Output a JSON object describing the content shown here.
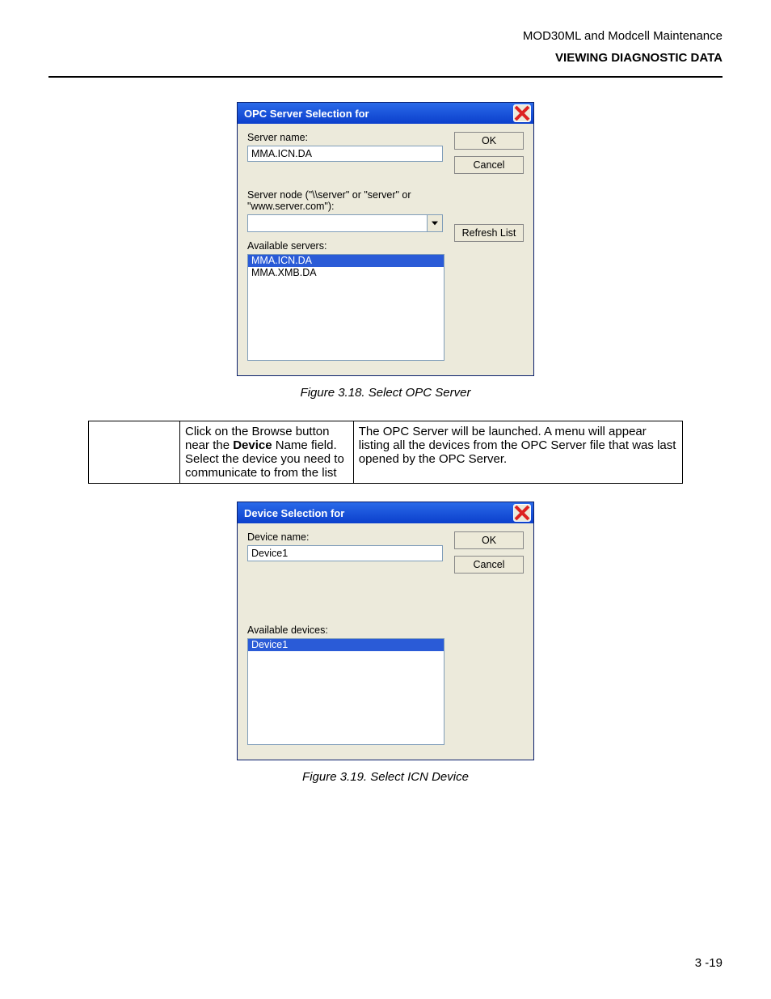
{
  "header": {
    "doc_title": "MOD30ML and Modcell Maintenance",
    "section": "VIEWING DIAGNOSTIC DATA"
  },
  "dialog1": {
    "title": "OPC Server Selection for",
    "server_name_label": "Server name:",
    "server_name_value": "MMA.ICN.DA",
    "server_node_label": "Server node (\"\\\\server\" or \"server\" or \"www.server.com\"):",
    "available_label": "Available servers:",
    "ok": "OK",
    "cancel": "Cancel",
    "refresh": "Refresh List",
    "list": [
      "MMA.ICN.DA",
      "MMA.XMB.DA"
    ],
    "selected_index": 0
  },
  "figure1_caption": "Figure 3.18. Select OPC Server",
  "table_row": {
    "left_pre": "Click on the Browse button near the ",
    "left_bold": "Device",
    "left_post": " Name field.\nSelect the device you need to communicate to from the list",
    "right": "The OPC Server will be launched. A menu will appear listing all the devices from the OPC Server file that was last opened by the OPC Server."
  },
  "dialog2": {
    "title": "Device Selection for",
    "device_name_label": "Device name:",
    "device_name_value": "Device1",
    "available_label": "Available devices:",
    "ok": "OK",
    "cancel": "Cancel",
    "list": [
      "Device1"
    ],
    "selected_index": 0
  },
  "figure2_caption": "Figure 3.19. Select ICN Device",
  "page_number": "3 -19"
}
